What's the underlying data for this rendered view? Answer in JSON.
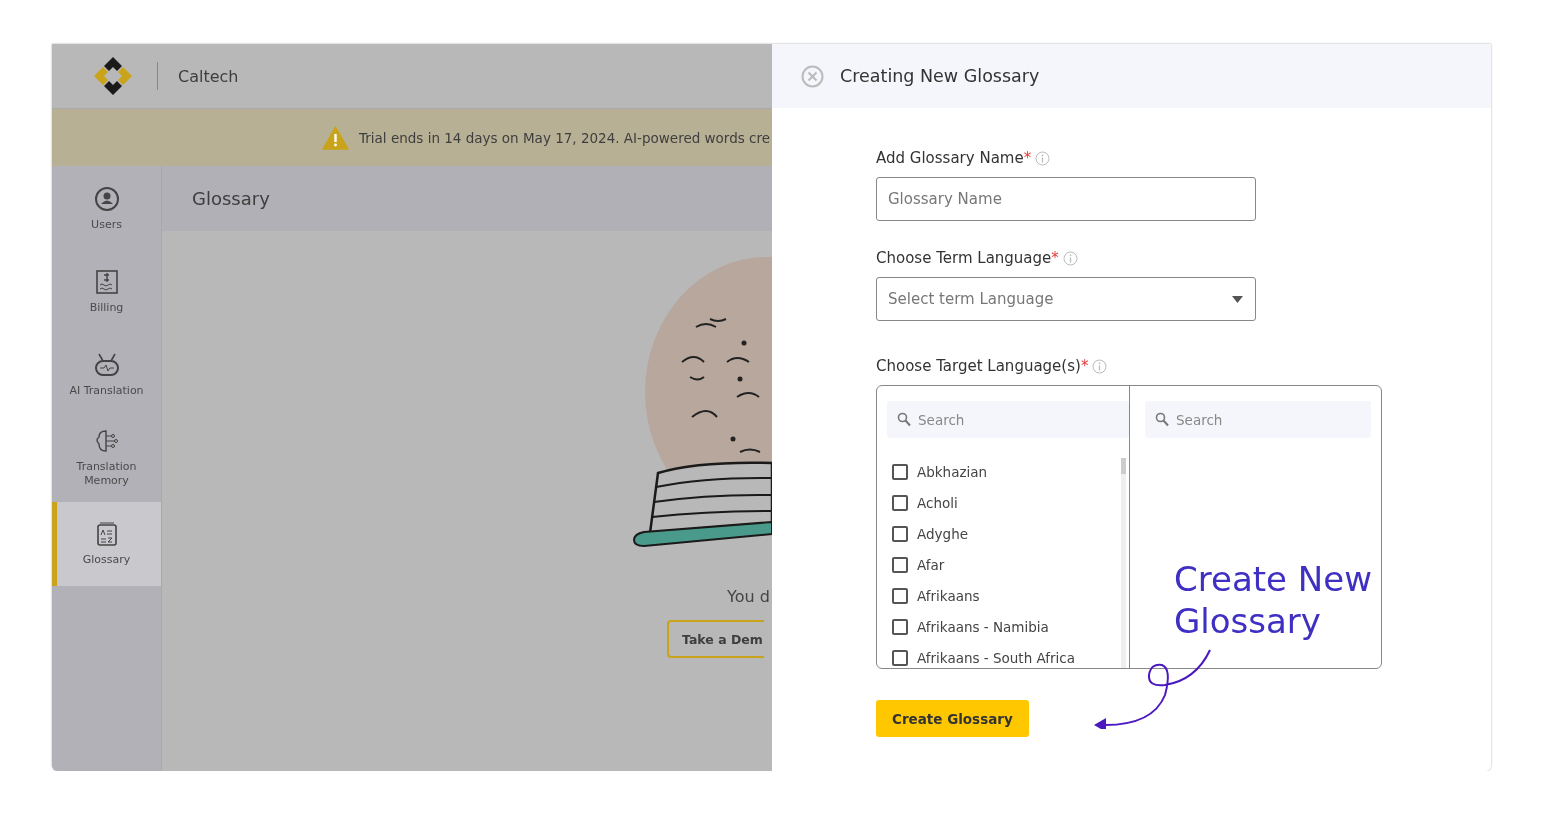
{
  "header": {
    "org_name": "Caltech"
  },
  "banner": {
    "text": "Trial ends in 14 days on May 17, 2024. AI-powered words cre"
  },
  "sidebar": {
    "items": [
      {
        "label": "Users",
        "selected": false
      },
      {
        "label": "Billing",
        "selected": false
      },
      {
        "label": "AI Translation",
        "selected": false
      },
      {
        "label": "Translation Memory",
        "selected": false
      },
      {
        "label": "Glossary",
        "selected": true
      }
    ]
  },
  "main": {
    "title": "Glossary",
    "empty_text": "You d",
    "demo_button": "Take a Dem"
  },
  "panel": {
    "title": "Creating New Glossary",
    "fields": [
      {
        "kind": "text",
        "label": "Add Glossary Name",
        "required_mark": "*",
        "placeholder": "Glossary Name"
      },
      {
        "kind": "select",
        "label": "Choose Term Language",
        "required_mark": "*",
        "placeholder": "Select term Language"
      }
    ],
    "target": {
      "label": "Choose Target Language(s)",
      "required_mark": "*",
      "available": {
        "search_placeholder": "Search",
        "languages": [
          {
            "name": "Abkhazian",
            "checked": false
          },
          {
            "name": "Acholi",
            "checked": false
          },
          {
            "name": "Adyghe",
            "checked": false
          },
          {
            "name": "Afar",
            "checked": false
          },
          {
            "name": "Afrikaans",
            "checked": false
          },
          {
            "name": "Afrikaans - Namibia",
            "checked": false
          },
          {
            "name": "Afrikaans - South Africa",
            "checked": false
          }
        ]
      },
      "chosen": {
        "search_placeholder": "Search"
      }
    },
    "submit_button": "Create Glossary"
  },
  "annotation": {
    "text": "Create New Glossary"
  }
}
